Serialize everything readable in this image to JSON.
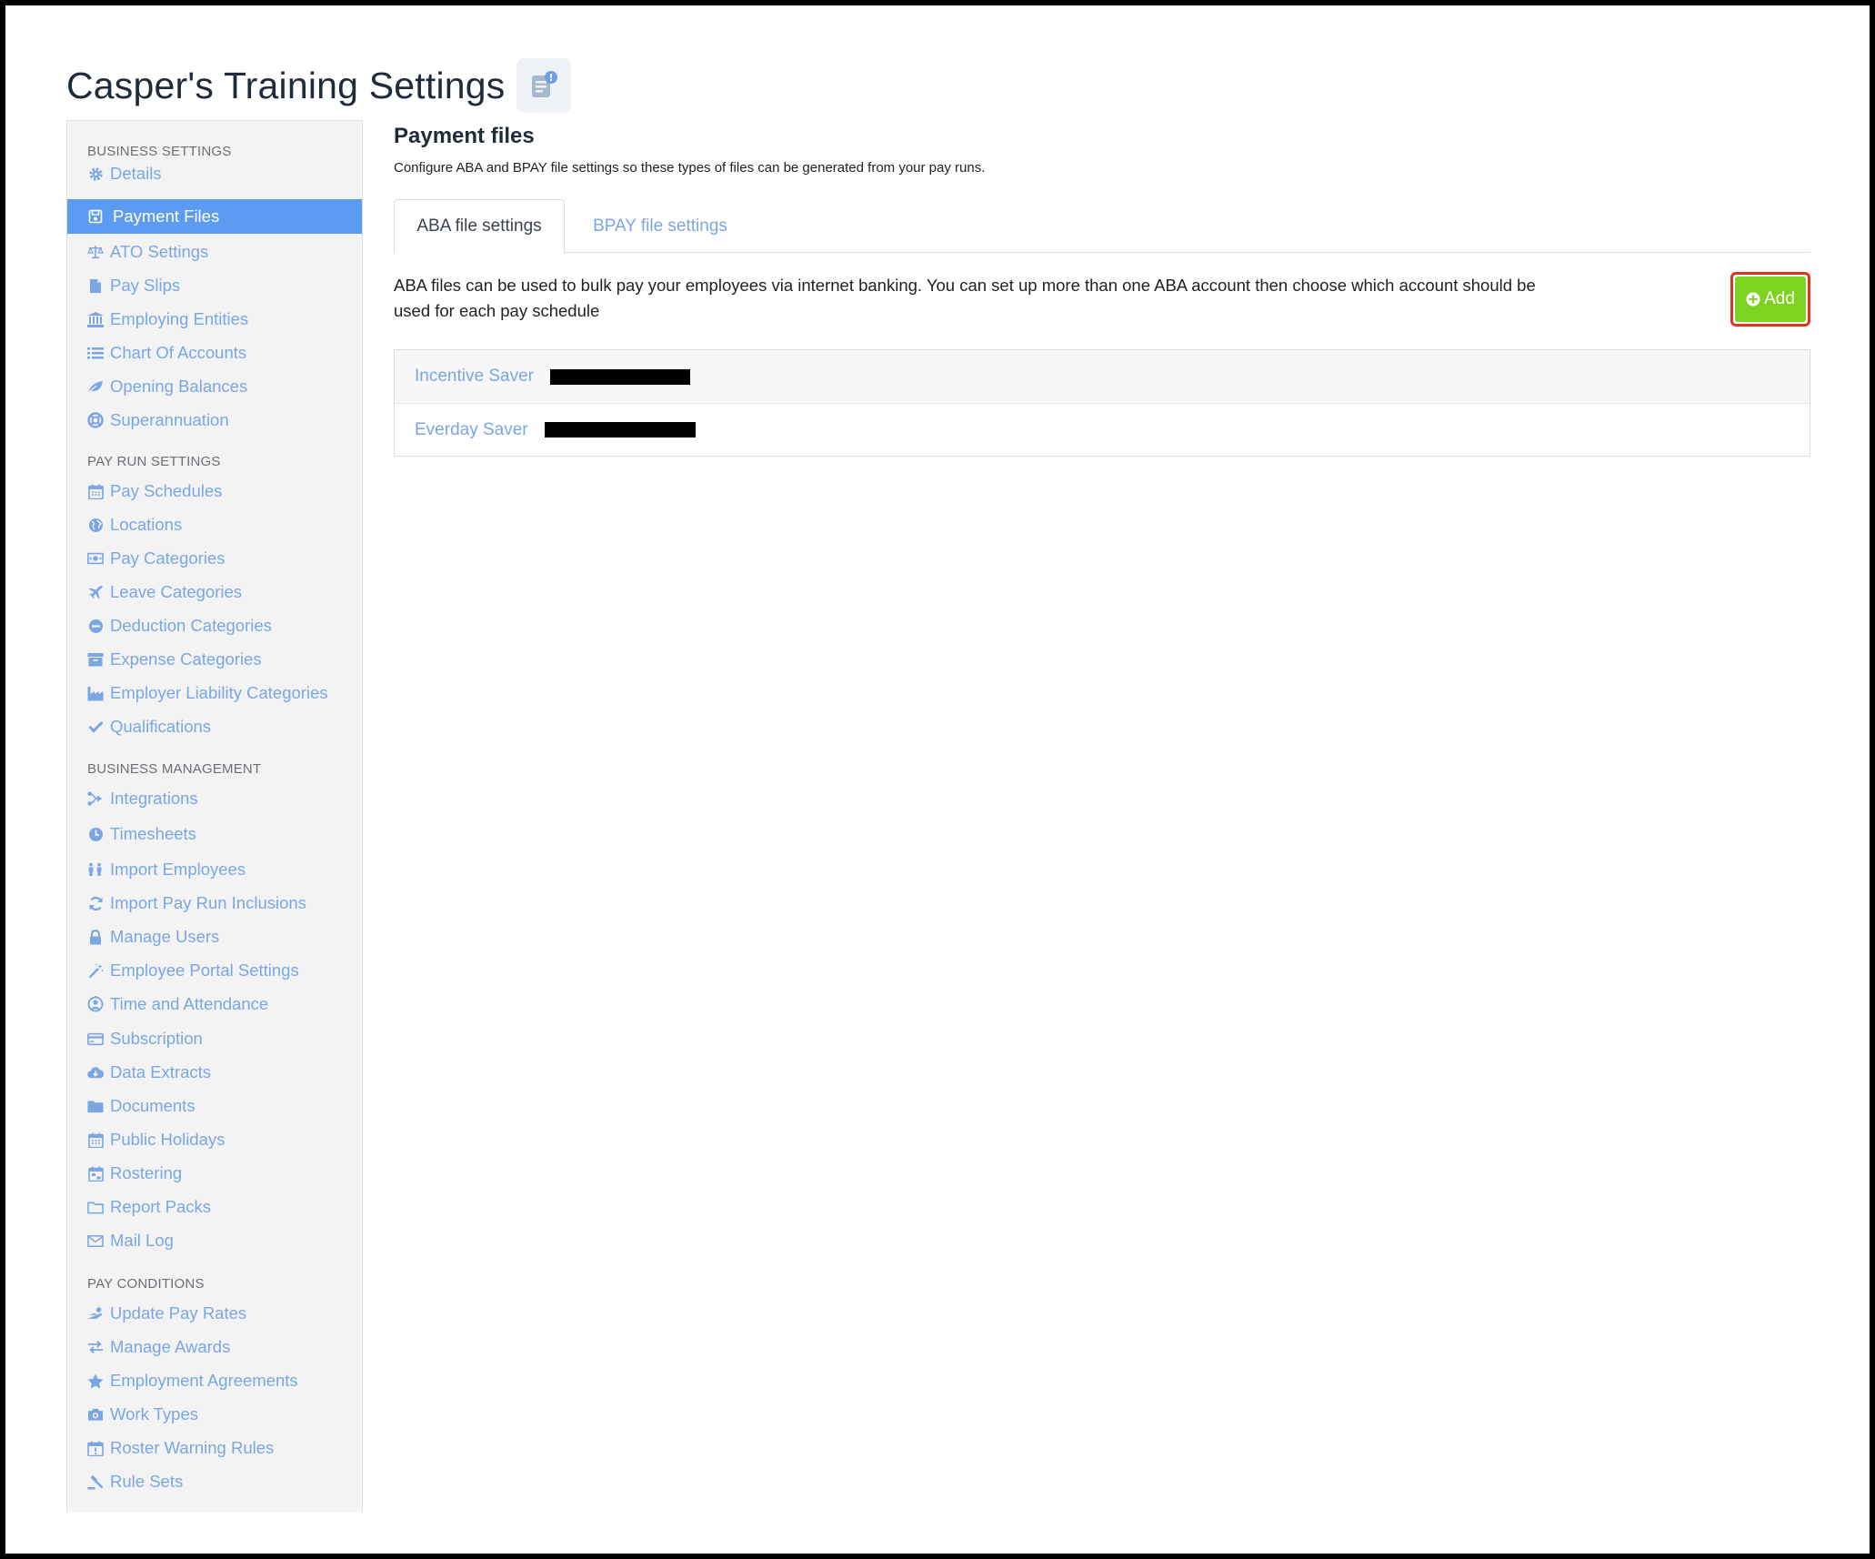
{
  "page": {
    "title": "Casper's Training Settings"
  },
  "sidebar": {
    "sections": [
      {
        "header": "BUSINESS SETTINGS",
        "items": [
          {
            "label": "Details",
            "icon": "gear-icon"
          },
          {
            "label": "Payment Files",
            "icon": "floppy-icon",
            "active": true
          },
          {
            "label": "ATO Settings",
            "icon": "scale-icon"
          },
          {
            "label": "Pay Slips",
            "icon": "file-icon"
          },
          {
            "label": "Employing Entities",
            "icon": "bank-icon"
          },
          {
            "label": "Chart Of Accounts",
            "icon": "list-icon"
          },
          {
            "label": "Opening Balances",
            "icon": "leaf-icon"
          },
          {
            "label": "Superannuation",
            "icon": "lifebuoy-icon"
          }
        ]
      },
      {
        "header": "PAY RUN SETTINGS",
        "items": [
          {
            "label": "Pay Schedules",
            "icon": "calendar-icon"
          },
          {
            "label": "Locations",
            "icon": "globe-icon"
          },
          {
            "label": "Pay Categories",
            "icon": "money-icon"
          },
          {
            "label": "Leave Categories",
            "icon": "plane-icon"
          },
          {
            "label": "Deduction Categories",
            "icon": "minus-circle-icon"
          },
          {
            "label": "Expense Categories",
            "icon": "archive-icon"
          },
          {
            "label": "Employer Liability Categories",
            "icon": "industry-icon"
          },
          {
            "label": "Qualifications",
            "icon": "check-icon"
          }
        ]
      },
      {
        "header": "BUSINESS MANAGEMENT",
        "items": [
          {
            "label": "Integrations",
            "icon": "integrations-icon"
          },
          {
            "label": "Timesheets",
            "icon": "clock-icon"
          },
          {
            "label": "Import Employees",
            "icon": "people-icon"
          },
          {
            "label": "Import Pay Run Inclusions",
            "icon": "refresh-icon"
          },
          {
            "label": "Manage Users",
            "icon": "lock-icon"
          },
          {
            "label": "Employee Portal Settings",
            "icon": "wand-icon"
          },
          {
            "label": "Time and Attendance",
            "icon": "user-clock-icon"
          },
          {
            "label": "Subscription",
            "icon": "credit-card-icon"
          },
          {
            "label": "Data Extracts",
            "icon": "cloud-download-icon"
          },
          {
            "label": "Documents",
            "icon": "folder-icon"
          },
          {
            "label": "Public Holidays",
            "icon": "calendar-icon"
          },
          {
            "label": "Rostering",
            "icon": "calendar-grid-icon"
          },
          {
            "label": "Report Packs",
            "icon": "folder-open-icon"
          },
          {
            "label": "Mail Log",
            "icon": "envelope-icon"
          }
        ]
      },
      {
        "header": "PAY CONDITIONS",
        "items": [
          {
            "label": "Update Pay Rates",
            "icon": "hand-money-icon"
          },
          {
            "label": "Manage Awards",
            "icon": "exchange-icon"
          },
          {
            "label": "Employment Agreements",
            "icon": "star-icon"
          },
          {
            "label": "Work Types",
            "icon": "camera-icon"
          },
          {
            "label": "Roster Warning Rules",
            "icon": "calendar-warning-icon"
          },
          {
            "label": "Rule Sets",
            "icon": "gavel-icon"
          }
        ]
      }
    ]
  },
  "main": {
    "title": "Payment files",
    "description": "Configure ABA and BPAY file settings so these types of files can be generated from your pay runs.",
    "tabs": [
      {
        "label": "ABA file settings",
        "active": true
      },
      {
        "label": "BPAY file settings",
        "active": false
      }
    ],
    "info_text": "ABA files can be used to bulk pay your employees via internet banking. You can set up more than one ABA account then choose which account should be used for each pay schedule",
    "add_label": "Add",
    "accounts": [
      {
        "name": "Incentive Saver"
      },
      {
        "name": "Everday Saver"
      }
    ]
  },
  "colors": {
    "link": "#7aa6e4",
    "active_nav": "#5b9cf2",
    "add_button": "#7ed321",
    "highlight_border": "#e2331f"
  }
}
